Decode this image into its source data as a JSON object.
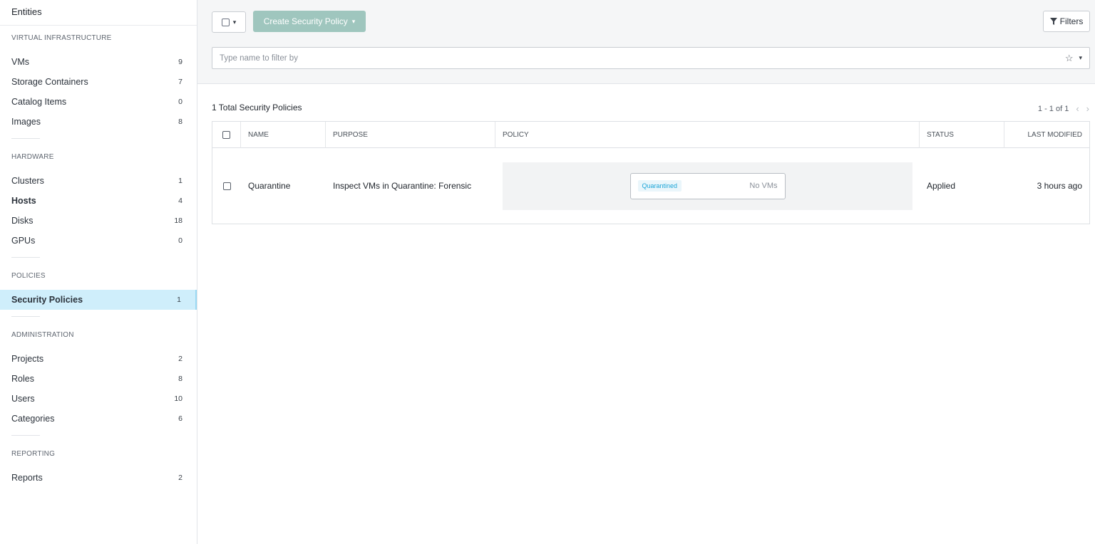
{
  "sidebar": {
    "header": "Entities",
    "sections": [
      {
        "title": "VIRTUAL INFRASTRUCTURE",
        "items": [
          {
            "label": "VMs",
            "count": "9"
          },
          {
            "label": "Storage Containers",
            "count": "7"
          },
          {
            "label": "Catalog Items",
            "count": "0"
          },
          {
            "label": "Images",
            "count": "8"
          }
        ]
      },
      {
        "title": "HARDWARE",
        "items": [
          {
            "label": "Clusters",
            "count": "1"
          },
          {
            "label": "Hosts",
            "count": "4"
          },
          {
            "label": "Disks",
            "count": "18"
          },
          {
            "label": "GPUs",
            "count": "0"
          }
        ]
      },
      {
        "title": "POLICIES",
        "items": [
          {
            "label": "Security Policies",
            "count": "1"
          }
        ]
      },
      {
        "title": "ADMINISTRATION",
        "items": [
          {
            "label": "Projects",
            "count": "2"
          },
          {
            "label": "Roles",
            "count": "8"
          },
          {
            "label": "Users",
            "count": "10"
          },
          {
            "label": "Categories",
            "count": "6"
          }
        ]
      },
      {
        "title": "REPORTING",
        "items": [
          {
            "label": "Reports",
            "count": "2"
          }
        ]
      }
    ]
  },
  "toolbar": {
    "create_label": "Create Security Policy",
    "filters_label": "Filters",
    "filter_placeholder": "Type name to filter by"
  },
  "summary": "1 Total Security Policies",
  "pager": "1 - 1 of 1",
  "table": {
    "headers": [
      "NAME",
      "PURPOSE",
      "POLICY",
      "STATUS",
      "LAST MODIFIED"
    ],
    "rows": [
      {
        "name": "Quarantine",
        "purpose": "Inspect VMs in Quarantine: Forensic",
        "policy_tag": "Quarantined",
        "policy_vms": "No VMs",
        "status": "Applied",
        "last_modified": "3 hours ago"
      }
    ]
  }
}
